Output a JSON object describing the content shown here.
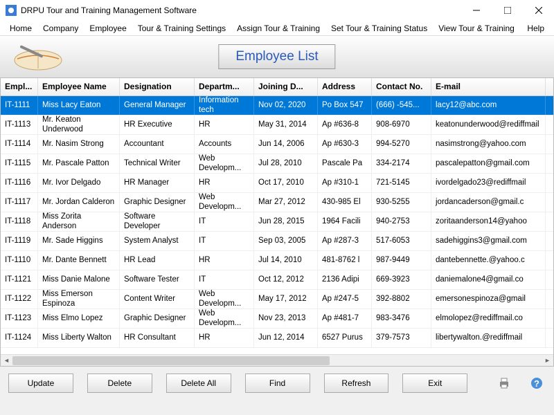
{
  "window": {
    "title": "DRPU Tour and Training Management Software"
  },
  "menu": {
    "home": "Home",
    "company": "Company",
    "employee": "Employee",
    "tour_settings": "Tour & Training Settings",
    "assign_tour": "Assign Tour & Training",
    "set_status": "Set Tour & Training Status",
    "view_tour": "View Tour & Training",
    "help": "Help"
  },
  "page_title": "Employee List",
  "columns": {
    "id": "Empl...",
    "name": "Employee Name",
    "desig": "Designation",
    "dept": "Departm...",
    "join": "Joining D...",
    "addr": "Address",
    "contact": "Contact No.",
    "email": "E-mail"
  },
  "rows": [
    {
      "id": "IT-1111",
      "name": "Miss Lacy Eaton",
      "desig": "General Manager",
      "dept": "Information tech",
      "join": "Nov 02, 2020",
      "addr": "Po Box 547",
      "contact": "(666) -545...",
      "email": "lacy12@abc.com"
    },
    {
      "id": "IT-1113",
      "name": "Mr. Keaton Underwood",
      "desig": "HR Executive",
      "dept": "HR",
      "join": "May 31, 2014",
      "addr": "Ap #636-8",
      "contact": "908-6970",
      "email": "keatonunderwood@rediffmail"
    },
    {
      "id": "IT-1114",
      "name": "Mr. Nasim Strong",
      "desig": "Accountant",
      "dept": "Accounts",
      "join": "Jun 14, 2006",
      "addr": "Ap #630-3",
      "contact": "994-5270",
      "email": "nasimstrong@yahoo.com"
    },
    {
      "id": "IT-1115",
      "name": "Mr. Pascale Patton",
      "desig": "Technical Writer",
      "dept": "Web Developm...",
      "join": "Jul 28, 2010",
      "addr": "Pascale Pa",
      "contact": "334-2174",
      "email": "pascalepatton@gmail.com"
    },
    {
      "id": "IT-1116",
      "name": "Mr. Ivor Delgado",
      "desig": "HR Manager",
      "dept": "HR",
      "join": "Oct 17, 2010",
      "addr": "Ap #310-1",
      "contact": "721-5145",
      "email": "ivordelgado23@rediffmail"
    },
    {
      "id": "IT-1117",
      "name": "Mr. Jordan Calderon",
      "desig": "Graphic Designer",
      "dept": "Web Developm...",
      "join": "Mar 27, 2012",
      "addr": "430-985 El",
      "contact": "930-5255",
      "email": "jordancaderson@gmail.c"
    },
    {
      "id": "IT-1118",
      "name": "Miss Zorita Anderson",
      "desig": "Software Developer",
      "dept": "IT",
      "join": "Jun 28, 2015",
      "addr": "1964 Facili",
      "contact": "940-2753",
      "email": "zoritaanderson14@yahoo"
    },
    {
      "id": "IT-1119",
      "name": "Mr. Sade Higgins",
      "desig": "System Analyst",
      "dept": "IT",
      "join": "Sep 03, 2005",
      "addr": "Ap #287-3",
      "contact": "517-6053",
      "email": "sadehiggins3@gmail.com"
    },
    {
      "id": "IT-1110",
      "name": "Mr. Dante Bennett",
      "desig": "HR Lead",
      "dept": "HR",
      "join": "Jul 14, 2010",
      "addr": "481-8762 l",
      "contact": "987-9449",
      "email": "dantebennette.@yahoo.c"
    },
    {
      "id": "IT-1121",
      "name": "Miss Danie Malone",
      "desig": "Software Tester",
      "dept": "IT",
      "join": "Oct 12, 2012",
      "addr": "2136 Adipi",
      "contact": "669-3923",
      "email": "daniemalone4@gmail.co"
    },
    {
      "id": "IT-1122",
      "name": "Miss Emerson Espinoza",
      "desig": "Content Writer",
      "dept": "Web Developm...",
      "join": "May 17, 2012",
      "addr": "Ap #247-5",
      "contact": "392-8802",
      "email": "emersonespinoza@gmail"
    },
    {
      "id": "IT-1123",
      "name": "Miss Elmo Lopez",
      "desig": "Graphic Designer",
      "dept": "Web Developm...",
      "join": "Nov 23, 2013",
      "addr": "Ap #481-7",
      "contact": "983-3476",
      "email": "elmolopez@rediffmail.co"
    },
    {
      "id": "IT-1124",
      "name": "Miss Liberty Walton",
      "desig": "HR Consultant",
      "dept": "HR",
      "join": "Jun 12, 2014",
      "addr": "6527 Purus",
      "contact": "379-7573",
      "email": "libertywalton.@rediffmail"
    }
  ],
  "buttons": {
    "update": "Update",
    "delete": "Delete",
    "delete_all": "Delete All",
    "find": "Find",
    "refresh": "Refresh",
    "exit": "Exit"
  }
}
